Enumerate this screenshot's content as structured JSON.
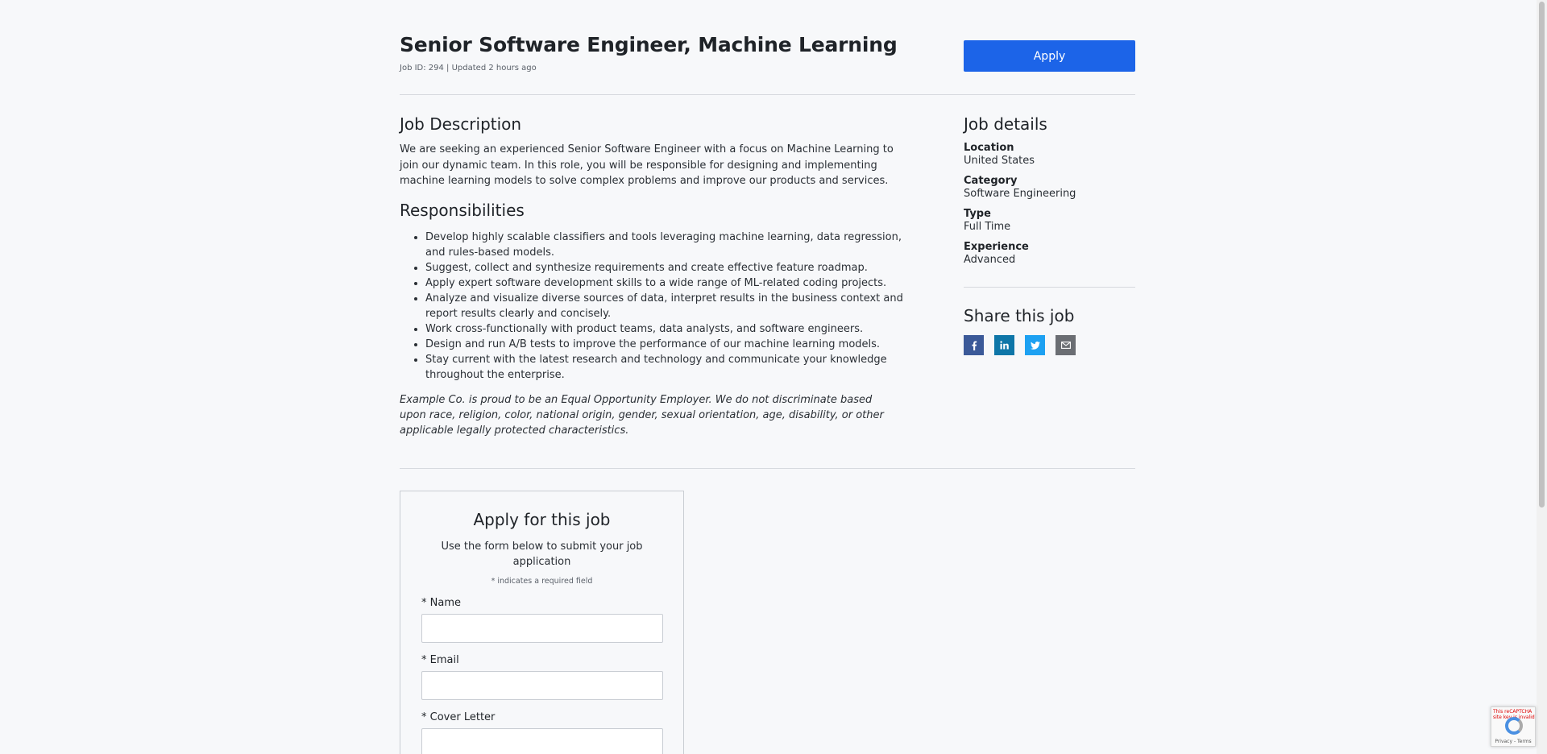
{
  "job": {
    "title": "Senior Software Engineer, Machine Learning",
    "meta": "Job ID: 294 | Updated 2 hours ago",
    "apply_label": "Apply"
  },
  "description": {
    "heading": "Job Description",
    "text": "We are seeking an experienced Senior Software Engineer with a focus on Machine Learning to join our dynamic team. In this role, you will be responsible for designing and implementing machine learning models to solve complex problems and improve our products and services."
  },
  "responsibilities": {
    "heading": "Responsibilities",
    "items": [
      "Develop highly scalable classifiers and tools leveraging machine learning, data regression, and rules-based models.",
      "Suggest, collect and synthesize requirements and create effective feature roadmap.",
      "Apply expert software development skills to a wide range of ML-related coding projects.",
      "Analyze and visualize diverse sources of data, interpret results in the business context and report results clearly and concisely.",
      "Work cross-functionally with product teams, data analysts, and software engineers.",
      "Design and run A/B tests to improve the performance of our machine learning models.",
      "Stay current with the latest research and technology and communicate your knowledge throughout the enterprise."
    ]
  },
  "eeo": "Example Co. is proud to be an Equal Opportunity Employer. We do not discriminate based upon race, religion, color, national origin, gender, sexual orientation, age, disability, or other applicable legally protected characteristics.",
  "details": {
    "heading": "Job details",
    "items": [
      {
        "label": "Location",
        "value": "United States"
      },
      {
        "label": "Category",
        "value": "Software Engineering"
      },
      {
        "label": "Type",
        "value": "Full Time"
      },
      {
        "label": "Experience",
        "value": "Advanced"
      }
    ]
  },
  "share": {
    "heading": "Share this job",
    "icons": [
      "facebook-icon",
      "linkedin-icon",
      "twitter-icon",
      "email-icon"
    ],
    "colors": {
      "facebook": "#3b5998",
      "linkedin": "#0e76a8",
      "twitter": "#1da1f2",
      "email": "#6b6e73"
    }
  },
  "form": {
    "title": "Apply for this job",
    "subtitle": "Use the form below to submit your job application",
    "required_note": "* indicates a required field",
    "name_label": "* Name",
    "email_label": "* Email",
    "cover_label": "* Cover Letter",
    "name_value": "",
    "email_value": "",
    "cover_value": ""
  },
  "recaptcha": {
    "warning": "This reCAPTCHA site key is invalid",
    "links": "Privacy - Terms"
  },
  "colors": {
    "accent": "#1c64e8",
    "background": "#f7f8fa"
  }
}
